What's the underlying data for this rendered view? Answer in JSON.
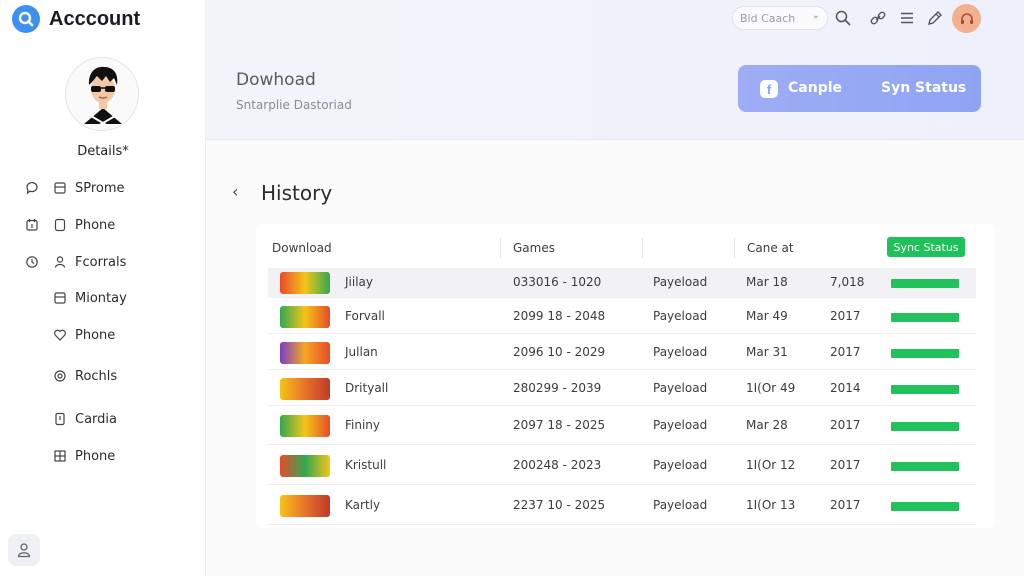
{
  "app": {
    "title": "Acccount"
  },
  "sidebar": {
    "details_label": "Details*",
    "items": [
      {
        "label": "SProme",
        "icon": "document-icon",
        "left_icon": "chat-bubble-icon"
      },
      {
        "label": "Phone",
        "icon": "square-icon",
        "left_icon": "calendar-icon"
      },
      {
        "label": "Fcorrals",
        "icon": "user-icon",
        "left_icon": "clock-icon"
      },
      {
        "label": "Miontay",
        "icon": "document-icon"
      },
      {
        "label": "Phone",
        "icon": "heart-icon"
      },
      {
        "label": "Rochls",
        "icon": "settings-icon"
      },
      {
        "label": "Cardia",
        "icon": "bookmark-icon"
      },
      {
        "label": "Phone",
        "icon": "grid-icon"
      }
    ]
  },
  "header": {
    "search_value": "Bld Caach",
    "heading": "Dowhoad",
    "subheading": "Sntarplie Dastoriad",
    "cta_primary": "Canple",
    "cta_secondary": "Syn Status",
    "cta_icon_letter": "f"
  },
  "history": {
    "title": "History",
    "columns": {
      "download": "Download",
      "games": "Games",
      "cane_at": "Cane at",
      "sync_status": "Sync Status"
    },
    "rows": [
      {
        "name": "Jiilay",
        "range": "033016 - 1020",
        "type": "Payeload",
        "date": "Mar 18",
        "year": "7,018",
        "thumb_colors": [
          "#e84b2a",
          "#f5c518",
          "#32a852"
        ]
      },
      {
        "name": "Forvall",
        "range": "2099 18 - 2048",
        "type": "Payeload",
        "date": "Mar 49",
        "year": "2017",
        "thumb_colors": [
          "#32a852",
          "#f5c518",
          "#e84b2a"
        ]
      },
      {
        "name": "Jullan",
        "range": "2096 10 - 2029",
        "type": "Payeload",
        "date": "Mar 31",
        "year": "2017",
        "thumb_colors": [
          "#7b3fc4",
          "#f5a623",
          "#e84b2a"
        ]
      },
      {
        "name": "Drityall",
        "range": "280299 - 2039",
        "type": "Payeload",
        "date": "1I(Or 49",
        "year": "2014",
        "thumb_colors": [
          "#f5c518",
          "#e8732a",
          "#c0392b"
        ]
      },
      {
        "name": "Fininy",
        "range": "2097 18 - 2025",
        "type": "Payeload",
        "date": "Mar 28",
        "year": "2017",
        "thumb_colors": [
          "#32a852",
          "#f5c518",
          "#e84b2a"
        ]
      },
      {
        "name": "Kristull",
        "range": "200248 - 2023",
        "type": "Payeload",
        "date": "1I(Or 12",
        "year": "2017",
        "thumb_colors": [
          "#e84b2a",
          "#32a852",
          "#f5c518"
        ]
      },
      {
        "name": "Kartly",
        "range": "2237 10 - 2025",
        "type": "Payeload",
        "date": "1I(Or 13",
        "year": "2017",
        "thumb_colors": [
          "#f5c518",
          "#e8732a",
          "#c0392b"
        ]
      }
    ]
  },
  "colors": {
    "accent": "#3d8ff0",
    "cta": "#93a7f4",
    "sync_green": "#21c15c",
    "user_badge": "#f2b08f"
  }
}
